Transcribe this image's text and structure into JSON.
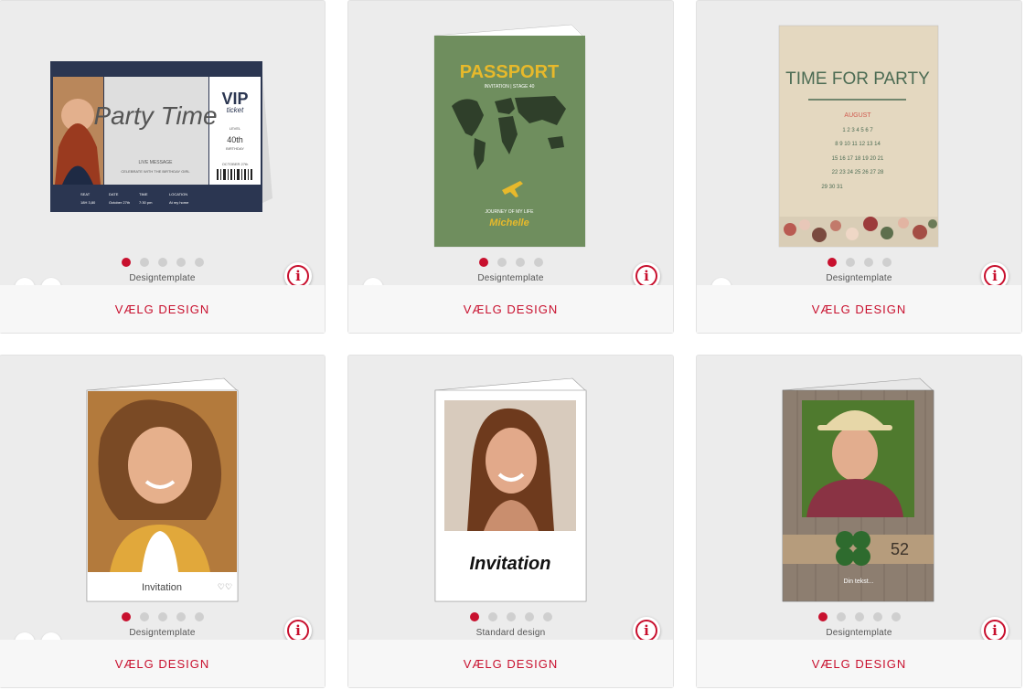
{
  "cards": [
    {
      "type_label": "Designtemplate",
      "select_label": "VÆLG DESIGN",
      "dots": 5,
      "preview": {
        "title": "Party Time",
        "ticket_vip": "VIP",
        "ticket_word": "ticket",
        "ticket_level": "LEVEL",
        "ticket_age": "40th",
        "ticket_bday": "BIRTHDAY",
        "ticket_date": "OCTOBER 27th",
        "message_1": "LIVE MESSAGE",
        "message_2": "CELEBRATE WITH THE BIRTHDAY GIRL",
        "info_seat_label": "SEAT",
        "info_seat_value": "18H 3,80",
        "info_date_label": "DATE",
        "info_date_value": "October 27th",
        "info_time_label": "TIME",
        "info_time_value": "7:30 pm",
        "info_location_label": "LOCATION",
        "info_location_value": "At my home"
      }
    },
    {
      "type_label": "Designtemplate",
      "select_label": "VÆLG DESIGN",
      "dots": 4,
      "preview": {
        "title": "PASSPORT",
        "subtitle": "INVITATION | STAGE 40",
        "journey": "JOURNEY OF MY LIFE",
        "name": "Michelle"
      }
    },
    {
      "type_label": "Designtemplate",
      "select_label": "VÆLG DESIGN",
      "dots": 4,
      "preview": {
        "title": "TIME FOR PARTY",
        "month": "AUGUST",
        "week1": "1  2  3  4  5  6  7",
        "week2": "8  9  10  11  12  13  14",
        "week3": "15  16  17  18  19  20  21",
        "week4": "22  23  24  25  26  27  28",
        "week5": "29  30  31"
      }
    },
    {
      "type_label": "Designtemplate",
      "select_label": "VÆLG DESIGN",
      "dots": 5,
      "preview": {
        "caption": "Invitation"
      }
    },
    {
      "type_label": "Standard design",
      "select_label": "VÆLG DESIGN",
      "dots": 5,
      "preview": {
        "caption": "Invitation"
      }
    },
    {
      "type_label": "Designtemplate",
      "select_label": "VÆLG DESIGN",
      "dots": 5,
      "preview": {
        "number": "52",
        "text": "Din tekst..."
      }
    }
  ],
  "colors": {
    "accent": "#c8102e",
    "card_bg": "#ececec",
    "button_bar": "#f7f7f7",
    "navy": "#2b3651",
    "passport_green": "#6f8e5e",
    "kraft": "#e4d8c0"
  },
  "icons": {
    "diamond": "diamond-icon",
    "paint": "paint-bucket-icon",
    "info": "info-icon"
  }
}
